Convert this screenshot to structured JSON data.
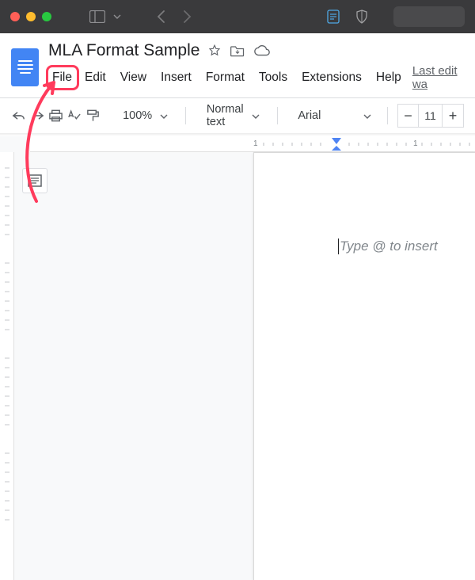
{
  "doc": {
    "title": "MLA Format Sample"
  },
  "menus": {
    "file": "File",
    "edit": "Edit",
    "view": "View",
    "insert": "Insert",
    "format": "Format",
    "tools": "Tools",
    "extensions": "Extensions",
    "help": "Help",
    "last_edit": "Last edit wa"
  },
  "toolbar": {
    "zoom": "100%",
    "style": "Normal text",
    "font": "Arial",
    "font_size": "11"
  },
  "ruler": {
    "tick_left": "1",
    "tick_right": "1"
  },
  "page": {
    "placeholder": "Type @ to insert"
  },
  "annotation": {
    "highlighted_menu": "file"
  }
}
